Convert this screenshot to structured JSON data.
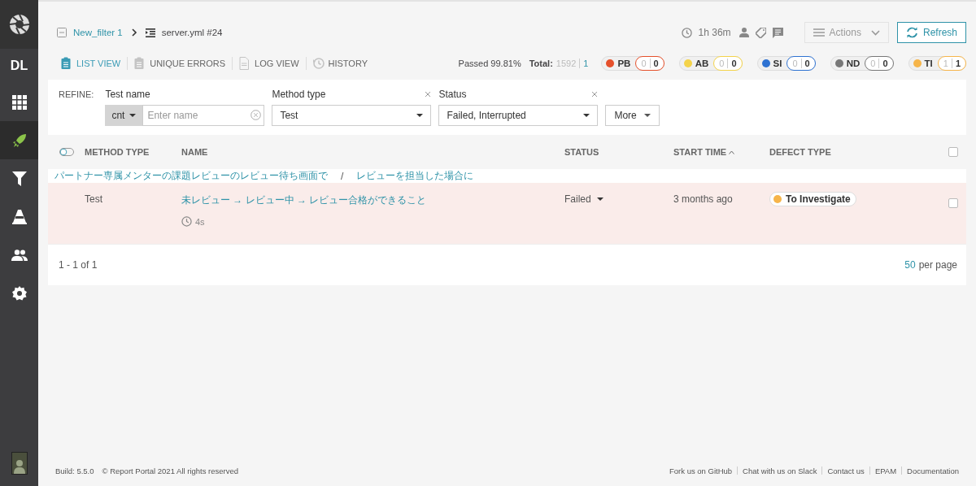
{
  "sidebar": {
    "items": [
      {
        "kind": "logo"
      },
      {
        "kind": "project",
        "label": "DL",
        "selected": false
      },
      {
        "kind": "dashboards",
        "selected": false
      },
      {
        "kind": "launches",
        "selected": true
      },
      {
        "kind": "filters",
        "selected": false
      },
      {
        "kind": "debug",
        "selected": false
      },
      {
        "kind": "members",
        "selected": false
      },
      {
        "kind": "settings",
        "selected": false
      }
    ]
  },
  "breadcrumb": [
    {
      "kind": "filter",
      "label": "New_filter 1"
    },
    {
      "kind": "launch",
      "label": "server.yml #24"
    }
  ],
  "header": {
    "duration": "1h 36m",
    "actions": "Actions",
    "refresh": "Refresh"
  },
  "view_tabs": [
    {
      "kind": "list",
      "label": "LIST VIEW",
      "selected": true
    },
    {
      "kind": "errors",
      "label": "UNIQUE ERRORS",
      "selected": false
    },
    {
      "kind": "log",
      "label": "LOG VIEW",
      "selected": false
    },
    {
      "kind": "history",
      "label": "HISTORY",
      "selected": false
    }
  ],
  "stats": {
    "passed": "Passed 99.81%",
    "total_label": "Total:",
    "total": "1592",
    "total_new": "1"
  },
  "defect_badges": [
    {
      "code": "PB",
      "color": "#e5502b",
      "total": "0",
      "new": "0"
    },
    {
      "code": "AB",
      "color": "#f4d34a",
      "total": "0",
      "new": "0"
    },
    {
      "code": "SI",
      "color": "#2e72d2",
      "total": "0",
      "new": "0"
    },
    {
      "code": "ND",
      "color": "#777777",
      "total": "0",
      "new": "0"
    },
    {
      "code": "TI",
      "color": "#f6b54a",
      "total": "1",
      "new": "1"
    }
  ],
  "refine": {
    "label": "REFINE:",
    "filters": [
      {
        "kind": "text",
        "label": "Test name",
        "condition": "cnt",
        "placeholder": "Enter name",
        "removable": false
      },
      {
        "kind": "select",
        "label": "Method type",
        "value": "Test",
        "removable": true
      },
      {
        "kind": "select",
        "label": "Status",
        "value": "Failed, Interrupted",
        "removable": true
      }
    ],
    "more": "More"
  },
  "table": {
    "columns": [
      {
        "label": "METHOD TYPE",
        "sorted": false
      },
      {
        "label": "NAME",
        "sorted": false
      },
      {
        "label": "STATUS",
        "sorted": false
      },
      {
        "label": "START TIME",
        "sorted": true
      },
      {
        "label": "DEFECT TYPE",
        "sorted": false
      }
    ],
    "all_checked": false,
    "group_path": [
      "パートナー専属メンターの課題レビューのレビュー待ち画面で",
      "/",
      "レビューを担当した場合に"
    ],
    "rows": [
      {
        "method_type": "Test",
        "name": "未レビュー → レビュー中 → レビュー合格ができること",
        "duration": "4s",
        "status": "Failed",
        "start_time": "3 months ago",
        "defect": {
          "label": "To Investigate",
          "color": "#f6b54a"
        },
        "highlighted": true,
        "checked": false
      }
    ]
  },
  "pagination": {
    "range": "1 - 1 of 1",
    "per_page": "50",
    "per_page_label": "per page"
  },
  "footer": {
    "build": "Build: 5.5.0",
    "copyright": "© Report Portal 2021 All rights reserved",
    "links": [
      "Fork us on GitHub",
      "Chat with us on Slack",
      "Contact us",
      "EPAM",
      "Documentation"
    ]
  }
}
